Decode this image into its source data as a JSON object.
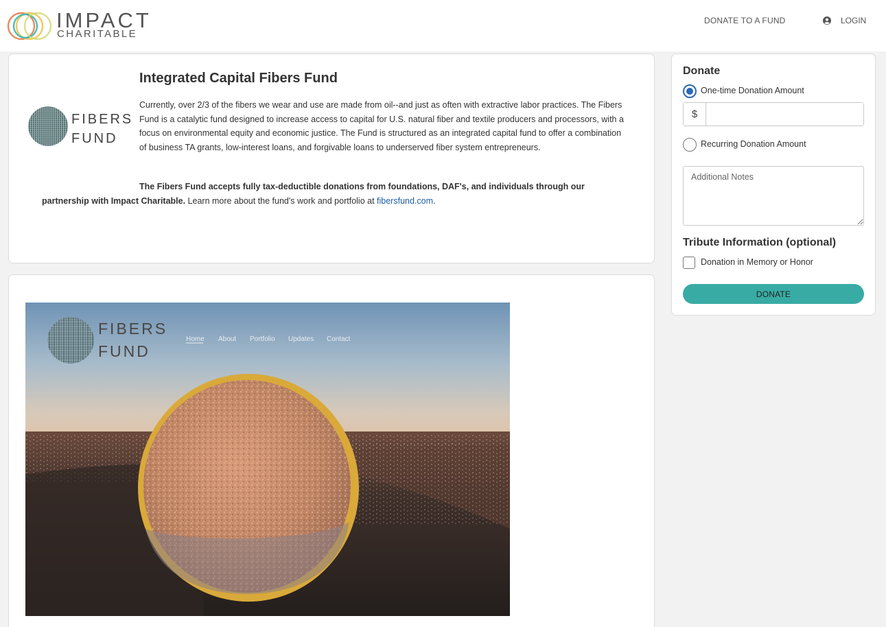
{
  "header": {
    "brand_name": "IMPACT",
    "brand_sub": "CHARITABLE",
    "nav_donate": "DONATE TO A FUND",
    "nav_login": "LOGIN"
  },
  "fund": {
    "logo_line1": "FIBERS",
    "logo_line2": "FUND",
    "title": "Integrated Capital Fibers Fund",
    "description": "Currently, over 2/3 of the fibers we wear and use are made from oil--and just as often with extractive labor practices. The Fibers Fund is a catalytic fund designed to increase access to capital for U.S. natural fiber and textile producers and processors, with a focus on environmental equity and economic justice. The Fund is structured as an integrated capital fund to offer a combination of business TA grants, low-interest loans, and forgivable loans to underserved fiber system entrepreneurs.",
    "note_bold": "The Fibers Fund accepts fully tax-deductible donations from foundations, DAF's, and individuals through our partnership with Impact Charitable.",
    "note_text": " Learn more about the fund's work and portfolio at ",
    "note_link": "fibersfund.com",
    "note_end": "."
  },
  "site_screenshot": {
    "logo_line1": "FIBERS",
    "logo_line2": "FUND",
    "nav": [
      "Home",
      "About",
      "Portfolio",
      "Updates",
      "Contact"
    ]
  },
  "donate_form": {
    "title": "Donate",
    "one_time_label": "One-time Donation Amount",
    "currency_symbol": "$",
    "amount_value": "",
    "recurring_label": "Recurring Donation Amount",
    "notes_placeholder": "Additional Notes",
    "tribute_title": "Tribute Information (optional)",
    "tribute_checkbox_label": "Donation in Memory or Honor",
    "donate_button": "DONATE"
  },
  "colors": {
    "accent": "#38aba4",
    "link": "#1f5fa8",
    "radio_selected": "#2b68b8"
  }
}
